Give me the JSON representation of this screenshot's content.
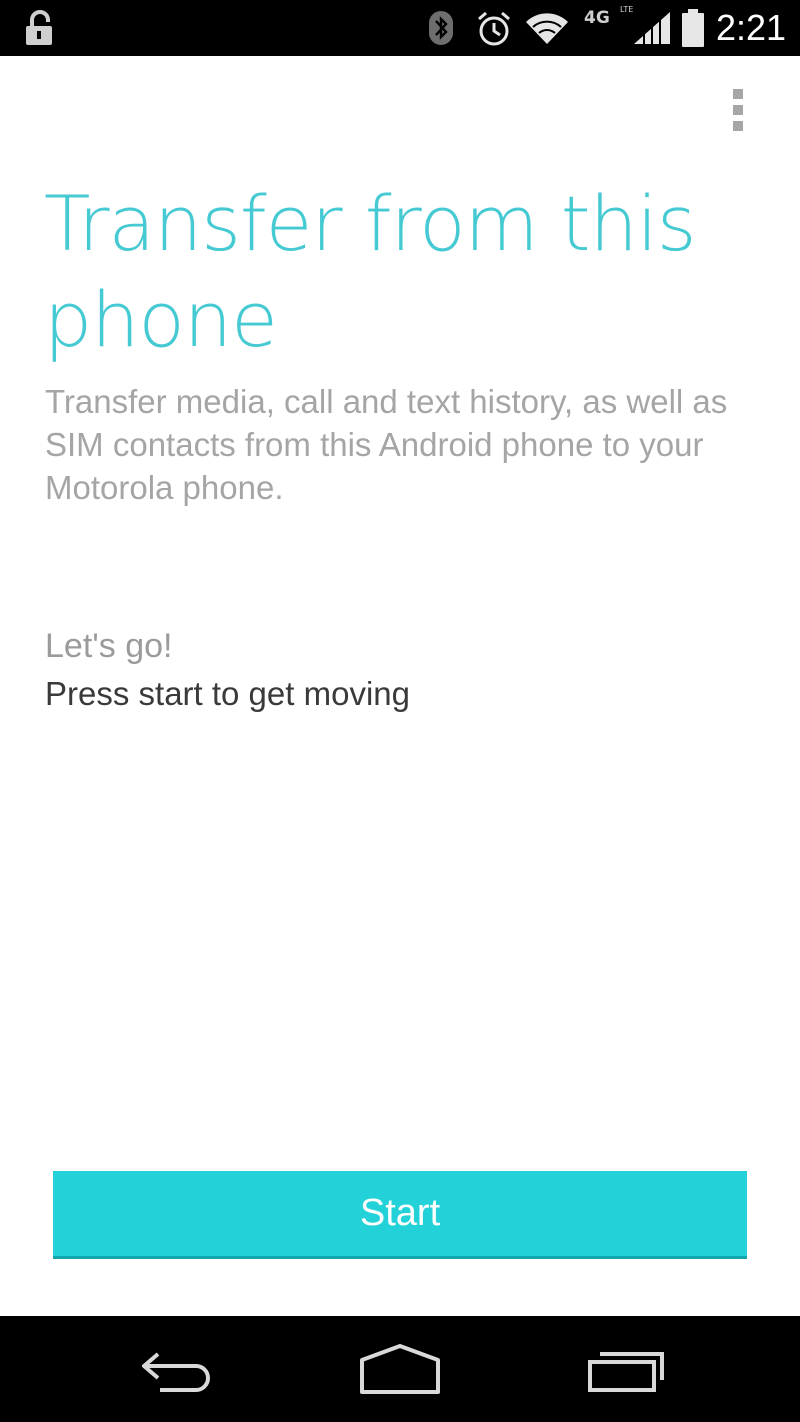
{
  "status_bar": {
    "network_type": "4G",
    "network_sub": "LTE",
    "time": "2:21",
    "icons": [
      "unlock-icon",
      "bluetooth-icon",
      "alarm-icon",
      "wifi-icon",
      "signal-icon",
      "battery-icon"
    ]
  },
  "toolbar": {
    "overflow_icon": "overflow-menu-icon"
  },
  "main": {
    "title": "Transfer from this phone",
    "description": "Transfer media, call and text history, as well as SIM contacts from this Android phone to your Motorola phone.",
    "lets_go": "Let's go!",
    "press_start": "Press start to get moving",
    "start_label": "Start"
  },
  "nav_bar": {
    "icons": [
      "back-icon",
      "home-icon",
      "recents-icon"
    ]
  },
  "colors": {
    "accent": "#45c9d2",
    "button": "#22d2d8",
    "status_bar": "#000000",
    "secondary_text": "#a5a5a5",
    "primary_text": "#3a3a3a"
  }
}
